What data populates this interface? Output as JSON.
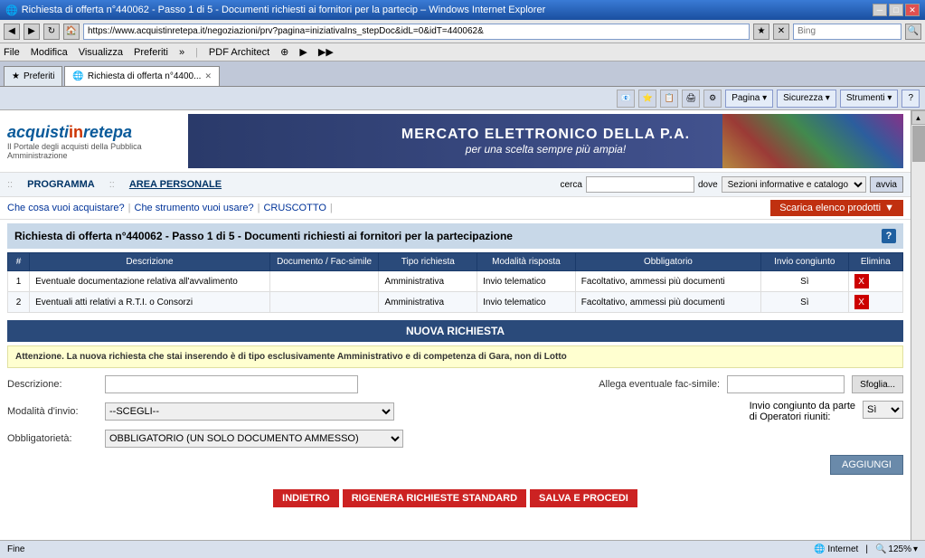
{
  "titlebar": {
    "title": "Richiesta di offerta n°440062 - Passo 1 di 5 - Documenti richiesti ai fornitori per la partecip – Windows Internet Explorer",
    "minimize": "─",
    "restore": "□",
    "close": "✕"
  },
  "addressbar": {
    "url": "https://www.acquistinretepa.it/negoziazioni/prv?pagina=iniziativaIns_stepDoc&idL=0&idT=440062&",
    "bing_placeholder": "Bing"
  },
  "menubar": {
    "items": [
      "File",
      "Modifica",
      "Visualizza",
      "Preferiti",
      "»",
      "PDF Architect",
      "⊕",
      "▶",
      "▶▶"
    ]
  },
  "tabs": [
    {
      "label": "Preferiti",
      "icon": "★",
      "active": false
    },
    {
      "label": "Richiesta di offerta n°4400...",
      "icon": "📄",
      "active": true
    }
  ],
  "ietoolbar": {
    "buttons": [
      "Pagina ▾",
      "Sicurezza ▾",
      "Strumenti ▾",
      "?"
    ]
  },
  "logo": {
    "name": "acquistinretepa",
    "tagline": "Il Portale degli acquisti della Pubblica Amministrazione"
  },
  "banner": {
    "title": "MERCATO ELETTRONICO DELLA P.A.",
    "subtitle": "per una scelta sempre più ampia!"
  },
  "navbar": {
    "separator": "::",
    "items": [
      "PROGRAMMA",
      "AREA PERSONALE"
    ],
    "search_label": "cerca",
    "search_placeholder": "",
    "dove_label": "dove",
    "dove_options": [
      "Sezioni informative e catalogo"
    ],
    "avvia_label": "avvia"
  },
  "subnav": {
    "links": [
      "Che cosa vuoi acquistare?",
      "Che strumento vuoi usare?",
      "CRUSCOTTO"
    ],
    "scarica_label": "Scarica elenco prodotti"
  },
  "page_title": {
    "text": "Richiesta di offerta n°440062 - Passo 1 di 5 - Documenti richiesti ai fornitori per la partecipazione",
    "help": "?"
  },
  "table": {
    "headers": [
      "#",
      "Descrizione",
      "Documento / Fac-simile",
      "Tipo richiesta",
      "Modalità risposta",
      "Obbligatorio",
      "Invio congiunto",
      "Elimina"
    ],
    "rows": [
      {
        "num": "1",
        "descrizione": "Eventuale documentazione relativa all'avvalimento",
        "documento": "",
        "tipo": "Amministrativa",
        "modalita": "Invio telematico",
        "obbligatorio": "Facoltativo, ammessi più documenti",
        "invio": "Sì",
        "elimina": "X"
      },
      {
        "num": "2",
        "descrizione": "Eventuali atti relativi a R.T.I. o Consorzi",
        "documento": "",
        "tipo": "Amministrativa",
        "modalita": "Invio telematico",
        "obbligatorio": "Facoltativo, ammessi più documenti",
        "invio": "Sì",
        "elimina": "X"
      }
    ]
  },
  "nuova_richiesta": {
    "title": "NUOVA RICHIESTA",
    "warning": "Attenzione. La nuova richiesta che stai inserendo è di tipo esclusivamente Amministrativo e di competenza di Gara, non di Lotto"
  },
  "form": {
    "descrizione_label": "Descrizione:",
    "descrizione_value": "",
    "allega_label": "Allega eventuale fac-simile:",
    "allega_value": "",
    "sfoglia_label": "Sfoglia...",
    "modalita_label": "Modalità d'invio:",
    "modalita_value": "--SCEGLI--",
    "modalita_options": [
      "--SCEGLI--"
    ],
    "invio_congiunto_label": "Invio congiunto da parte di Operatori riuniti:",
    "invio_congiunto_value": "Sì",
    "invio_options": [
      "Sì"
    ],
    "obbligatorieta_label": "Obbligatorietà:",
    "obbligatorieta_value": "OBBLIGATORIO (UN SOLO DOCUMENTO AMMESSO)",
    "obbligatorieta_options": [
      "OBBLIGATORIO (UN SOLO DOCUMENTO AMMESSO)"
    ],
    "aggiungi_label": "AGGIUNGI"
  },
  "bottom_buttons": {
    "indietro": "INDIETRO",
    "rigenera": "RIGENERA RICHIESTE STANDARD",
    "salva": "SALVA E PROCEDI"
  },
  "statusbar": {
    "status": "Fine",
    "zone": "Internet",
    "zoom": "125%"
  }
}
